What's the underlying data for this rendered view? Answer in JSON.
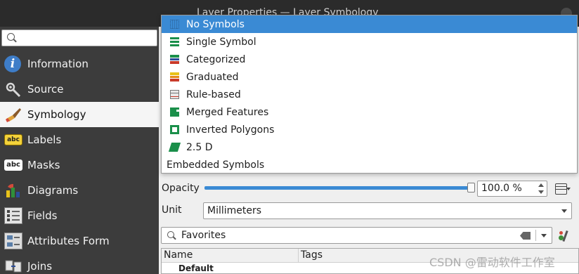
{
  "window": {
    "title_fragment": "Layer Properties — Layer Symbology"
  },
  "sidebar": {
    "search": {
      "value": "",
      "placeholder": ""
    },
    "items": [
      {
        "label": "Information",
        "icon": "info-icon",
        "selected": false
      },
      {
        "label": "Source",
        "icon": "source-icon",
        "selected": false
      },
      {
        "label": "Symbology",
        "icon": "symbology-paintbrush-icon",
        "selected": true
      },
      {
        "label": "Labels",
        "icon": "labels-abc-icon",
        "selected": false
      },
      {
        "label": "Masks",
        "icon": "masks-abc-icon",
        "selected": false
      },
      {
        "label": "Diagrams",
        "icon": "diagrams-icon",
        "selected": false
      },
      {
        "label": "Fields",
        "icon": "fields-icon",
        "selected": false
      },
      {
        "label": "Attributes Form",
        "icon": "attributes-form-icon",
        "selected": false
      },
      {
        "label": "Joins",
        "icon": "joins-icon",
        "selected": false
      }
    ]
  },
  "renderer_dropdown": {
    "options": [
      {
        "label": "No Symbols",
        "icon": "no-symbols-icon",
        "highlighted": true
      },
      {
        "label": "Single Symbol",
        "icon": "single-symbol-icon",
        "highlighted": false
      },
      {
        "label": "Categorized",
        "icon": "categorized-icon",
        "highlighted": false
      },
      {
        "label": "Graduated",
        "icon": "graduated-icon",
        "highlighted": false
      },
      {
        "label": "Rule-based",
        "icon": "rule-based-icon",
        "highlighted": false
      },
      {
        "label": "Merged Features",
        "icon": "merged-features-icon",
        "highlighted": false
      },
      {
        "label": "Inverted Polygons",
        "icon": "inverted-polygons-icon",
        "highlighted": false
      },
      {
        "label": "2.5 D",
        "icon": "2-5d-icon",
        "highlighted": false
      },
      {
        "label": "Embedded Symbols",
        "icon": "",
        "highlighted": false
      }
    ]
  },
  "opacity": {
    "label": "Opacity",
    "value_text": "100.0 %",
    "fraction": 1.0
  },
  "unit": {
    "label": "Unit",
    "selected": "Millimeters"
  },
  "symbol_library": {
    "filter_value": "Favorites",
    "columns": [
      "Name",
      "Tags"
    ],
    "rows": [
      {
        "name": "Default",
        "tags": ""
      }
    ]
  },
  "watermark": "CSDN @雷动软件工作室",
  "colors": {
    "accent": "#3a8ad4",
    "sidebar_bg": "#3c3c3c",
    "symbol_green": "#1a8f4a"
  }
}
